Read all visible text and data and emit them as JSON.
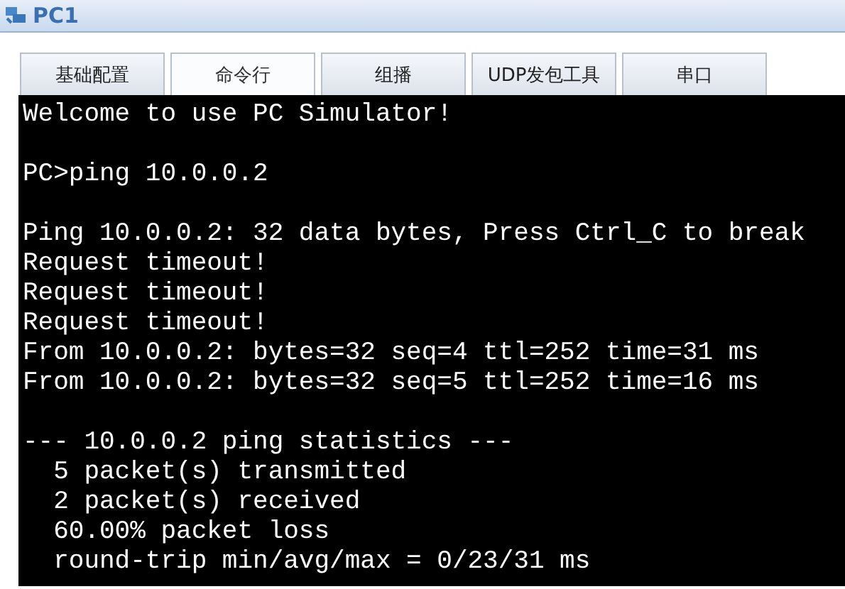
{
  "window": {
    "title": "PC1"
  },
  "tabs": [
    {
      "label": "基础配置",
      "selected": false
    },
    {
      "label": "命令行",
      "selected": true
    },
    {
      "label": "组播",
      "selected": false
    },
    {
      "label": "UDP发包工具",
      "selected": false
    },
    {
      "label": "串口",
      "selected": false
    }
  ],
  "console": {
    "blocks": [
      [
        "Welcome to use PC Simulator!"
      ],
      [
        "PC>ping 10.0.0.2"
      ],
      [
        "Ping 10.0.0.2: 32 data bytes, Press Ctrl_C to break",
        "Request timeout!",
        "Request timeout!",
        "Request timeout!",
        "From 10.0.0.2: bytes=32 seq=4 ttl=252 time=31 ms",
        "From 10.0.0.2: bytes=32 seq=5 ttl=252 time=16 ms"
      ],
      [
        "--- 10.0.0.2 ping statistics ---",
        "  5 packet(s) transmitted",
        "  2 packet(s) received",
        "  60.00% packet loss",
        "  round-trip min/avg/max = 0/23/31 ms"
      ]
    ]
  }
}
